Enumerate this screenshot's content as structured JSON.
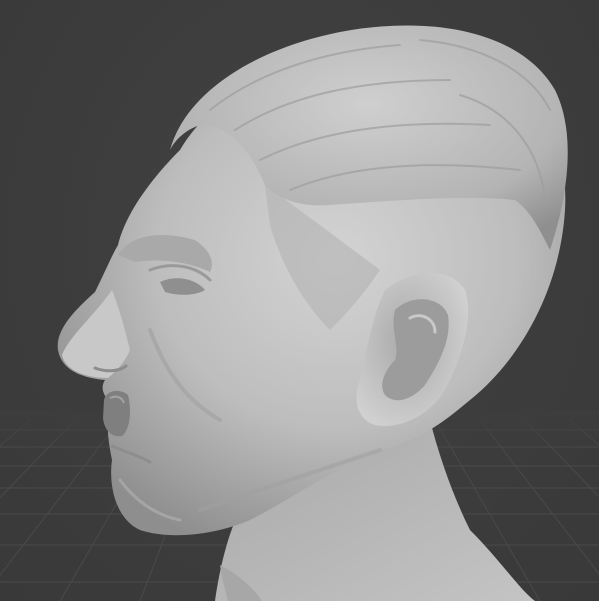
{
  "viewport": {
    "background_color": "#3d3d3d",
    "grid_color": "#4a4a4a",
    "model_color": "#b9b9b9",
    "model_shading": "solid-matcap",
    "model": "sculpted-head-bust-profile-left"
  }
}
